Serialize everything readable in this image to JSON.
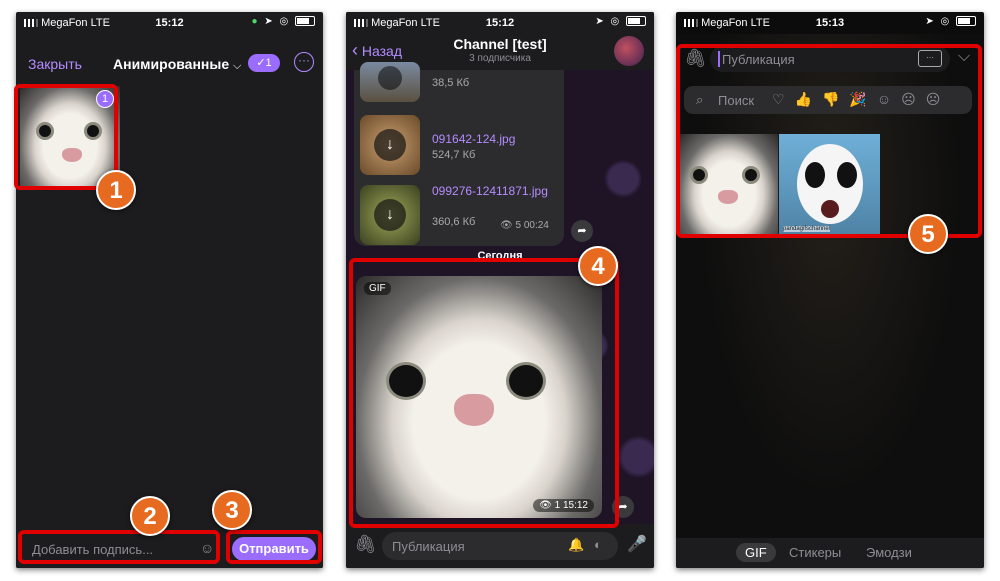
{
  "status": {
    "carrier": "MegaFon",
    "network": "LTE",
    "time1": "15:12",
    "time2": "15:12",
    "time3": "15:13"
  },
  "picker": {
    "close": "Закрыть",
    "album": "Анимированные",
    "selected_count": "1",
    "item_badge": "1",
    "caption_placeholder": "Добавить подпись...",
    "send": "Отправить"
  },
  "chat": {
    "back": "Назад",
    "title": "Channel [test]",
    "subtitle": "3 подписчика",
    "files": [
      {
        "name": "",
        "size": "38,5 Кб"
      },
      {
        "name": "091642-124.jpg",
        "size": "524,7 Кб"
      },
      {
        "name": "099276-12411871.jpg",
        "size": "360,6 Кб"
      }
    ],
    "views": "5 00:24",
    "date": "Сегодня",
    "gif_label": "GIF",
    "gif_meta": "1 15:12",
    "input_placeholder": "Публикация"
  },
  "gifs": {
    "input_placeholder": "Публикация",
    "search": "Поиск",
    "tabs": [
      "GIF",
      "Стикеры",
      "Эмодзи"
    ],
    "panda_caption": "pandagifschannel"
  },
  "steps": [
    "1",
    "2",
    "3",
    "4",
    "5"
  ],
  "colors": {
    "accent": "#9b6dff",
    "annotation_red": "#e00000",
    "badge_orange": "#e66a1f"
  }
}
